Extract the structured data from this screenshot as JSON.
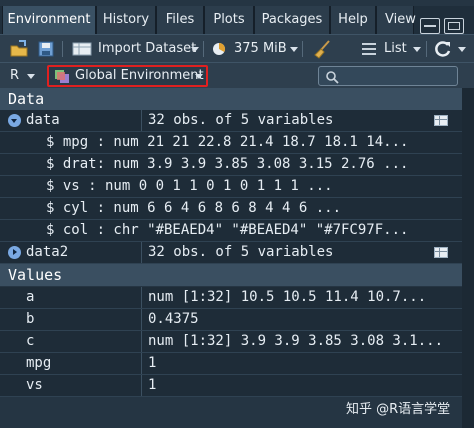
{
  "tabs": [
    {
      "label": "Environment",
      "active": true
    },
    {
      "label": "History"
    },
    {
      "label": "Files"
    },
    {
      "label": "Plots"
    },
    {
      "label": "Packages"
    },
    {
      "label": "Help"
    },
    {
      "label": "View"
    }
  ],
  "toolbar": {
    "import_label": "Import Dataset",
    "memory": "375 MiB",
    "view_mode": "List"
  },
  "env": {
    "language": "R",
    "environment": "Global Environment"
  },
  "data_section": {
    "title": "Data",
    "rows": [
      {
        "name": "data",
        "value": "32 obs. of 5 variables",
        "expanded": true
      },
      {
        "sub": "$ mpg : num  21 21 22.8 21.4 18.7 18.1 14..."
      },
      {
        "sub": "$ drat: num  3.9 3.9 3.85 3.08 3.15 2.76 ..."
      },
      {
        "sub": "$ vs  : num  0 0 1 1 0 1 0 1 1 1 ..."
      },
      {
        "sub": "$ cyl : num  6 6 4 6 8 6 8 4 4 6 ..."
      },
      {
        "sub": "$ col : chr  \"#BEAED4\" \"#BEAED4\" \"#7FC97F..."
      },
      {
        "name": "data2",
        "value": "32 obs. of 5 variables",
        "expanded": false
      }
    ]
  },
  "values_section": {
    "title": "Values",
    "rows": [
      {
        "name": "a",
        "value": "num [1:32] 10.5 10.5 11.4 10.7..."
      },
      {
        "name": "b",
        "value": "0.4375"
      },
      {
        "name": "c",
        "value": "num [1:32] 3.9 3.9 3.85 3.08 3.1..."
      },
      {
        "name": "mpg",
        "value": "1"
      },
      {
        "name": "vs",
        "value": "1"
      }
    ]
  },
  "watermark": "知乎 @R语言学堂",
  "colors": {
    "highlight": "#e02020",
    "accent": "#7aa9e3"
  }
}
